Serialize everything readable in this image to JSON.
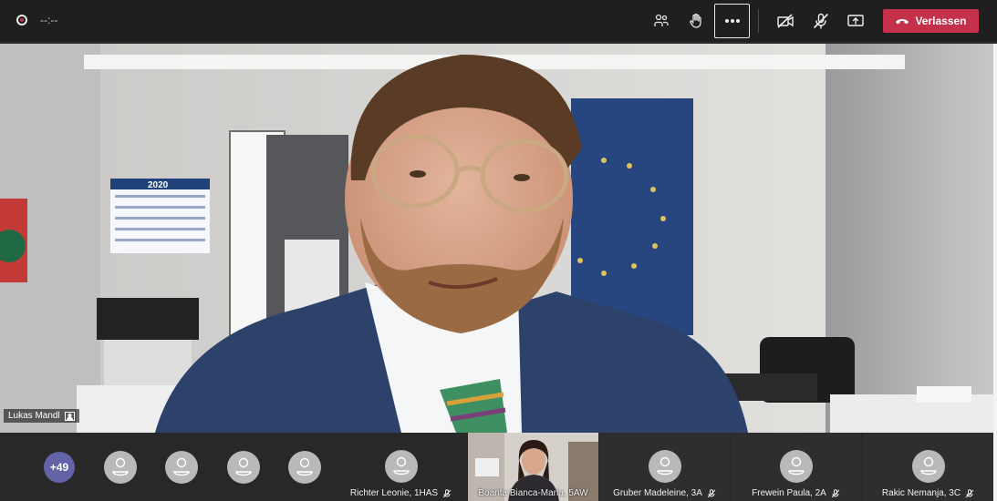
{
  "toolbar": {
    "recording_time": "--:--",
    "leave_label": "Verlassen",
    "leave_color": "#c4314b",
    "icons": [
      "participants-icon",
      "raise-hand-icon",
      "more-options-icon",
      "camera-off-icon",
      "mic-off-icon",
      "share-screen-icon",
      "hang-up-icon"
    ]
  },
  "main_video": {
    "speaker_name": "Lukas Mandl",
    "calendar_year": "2020"
  },
  "participants": {
    "overflow_count": "+49",
    "tiles": [
      {
        "name": "Richter Leonie, 1HAS",
        "muted": true,
        "video": false
      },
      {
        "name": "Boanta Bianca-Maria, 5AW",
        "muted": false,
        "video": true
      },
      {
        "name": "Gruber Madeleine, 3A",
        "muted": true,
        "video": false
      },
      {
        "name": "Frewein Paula, 2A",
        "muted": true,
        "video": false
      },
      {
        "name": "Rakic Nemanja, 3C",
        "muted": true,
        "video": false
      }
    ]
  }
}
